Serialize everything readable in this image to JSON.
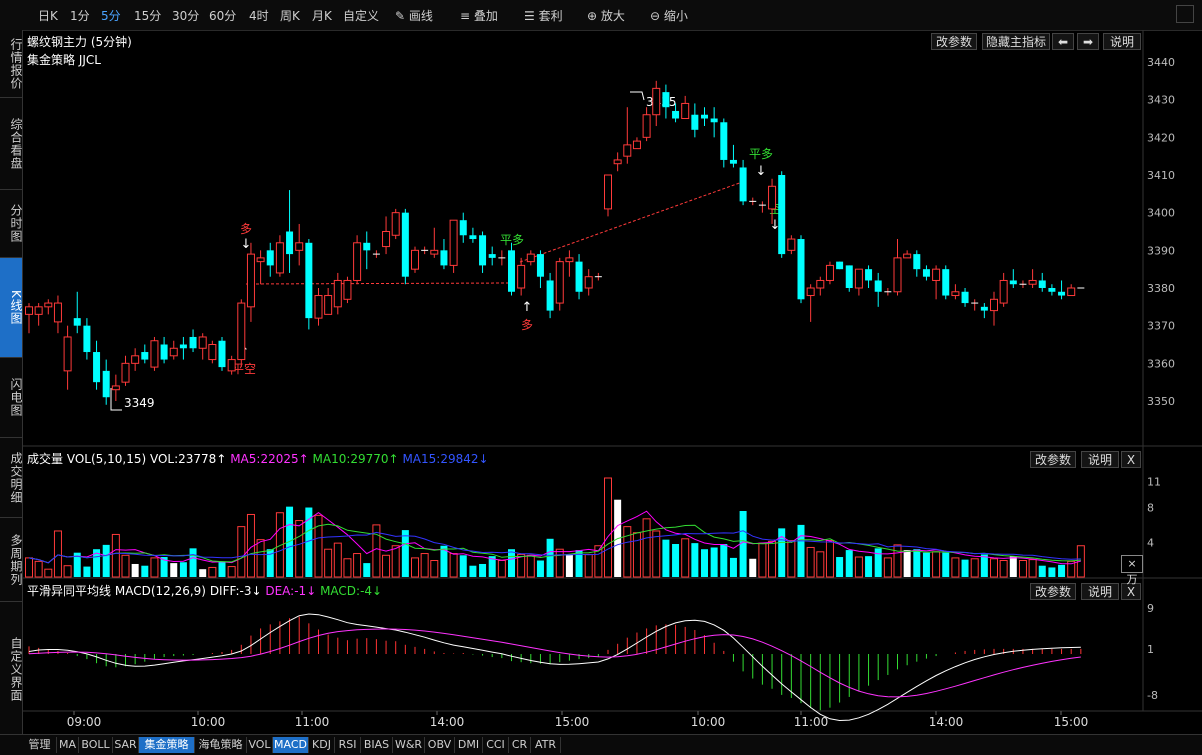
{
  "toolbar": {
    "periods": [
      "日K",
      "1分",
      "5分",
      "15分",
      "30分",
      "60分",
      "4时",
      "周K",
      "月K",
      "自定义"
    ],
    "selected_period": "5分",
    "draw_label": "画线",
    "overlay_label": "叠加",
    "arbitrage_label": "套利",
    "zoom_in_label": "放大",
    "zoom_out_label": "缩小"
  },
  "sidebar": {
    "items": [
      {
        "label": "行情报价"
      },
      {
        "label": "综合看盘"
      },
      {
        "label": "分时图"
      },
      {
        "label": "K线图",
        "selected": true
      },
      {
        "label": "闪电图"
      },
      {
        "label": "成交明细"
      },
      {
        "label": "多周期列"
      },
      {
        "label": "自定义界面"
      }
    ]
  },
  "main_panel": {
    "title": "螺纹钢主力 (5分钟)",
    "strategy": "集金策略 JJCL",
    "buttons": {
      "params": "改参数",
      "hide": "隐藏主指标",
      "help": "说明"
    },
    "y_ticks": [
      3440,
      3430,
      3420,
      3410,
      3400,
      3390,
      3380,
      3370,
      3360,
      3350
    ],
    "annotations": {
      "high": "3435",
      "low": "3349"
    },
    "signals": {
      "buy_open_1": "多",
      "close_short_1": "平空",
      "close_long_1": "平多",
      "buy_open_2": "多",
      "close_long_2": "平多",
      "sell_open": "空"
    }
  },
  "vol_panel": {
    "label": "成交量",
    "params": "VOL(5,10,15)",
    "vol": "VOL:23778↑",
    "ma5": "MA5:22025↑",
    "ma10": "MA10:29770↑",
    "ma15": "MA15:29842↓",
    "y_ticks": [
      "11",
      "8",
      "4"
    ],
    "unit": "×万",
    "buttons": {
      "params": "改参数",
      "help": "说明",
      "close": "X"
    }
  },
  "macd_panel": {
    "label": "平滑异同平均线",
    "params": "MACD(12,26,9)",
    "diff": "DIFF:-3↓",
    "dea": "DEA:-1↓",
    "macd": "MACD:-4↓",
    "y_ticks": [
      "9",
      "1",
      "-8"
    ],
    "buttons": {
      "params": "改参数",
      "help": "说明",
      "close": "X"
    }
  },
  "time_axis": [
    "09:00",
    "10:00",
    "11:00",
    "14:00",
    "15:00",
    "10:00",
    "11:00",
    "14:00",
    "15:00"
  ],
  "bottom_tabs": [
    "管理",
    "MA",
    "BOLL",
    "SAR",
    "集金策略",
    "海龟策略",
    "VOL",
    "MACD",
    "KDJ",
    "RSI",
    "BIAS",
    "W&R",
    "OBV",
    "DMI",
    "CCI",
    "CR",
    "ATR"
  ],
  "colors": {
    "up": "#ff3a3a",
    "down": "#00ffff",
    "ma5": "#ff00ff",
    "ma10": "#33dd33",
    "ma15": "#3333ff",
    "diff": "#ffffff",
    "dea": "#ff33ff",
    "macd_up": "#ff3333",
    "macd_down": "#33dd33",
    "panel_border": "#333333",
    "selected": "#1e6fc7"
  },
  "chart_data": {
    "type": "candlestick",
    "ylim": [
      3345,
      3442
    ],
    "candles": [
      [
        3373,
        3375,
        3368,
        3376
      ],
      [
        3373,
        3375,
        3370,
        3376
      ],
      [
        3375,
        3376,
        3373,
        3377
      ],
      [
        3371,
        3376,
        3368,
        3378
      ],
      [
        3358,
        3367,
        3353,
        3370
      ],
      [
        3372,
        3370,
        3368,
        3379
      ],
      [
        3370,
        3363,
        3361,
        3372
      ],
      [
        3363,
        3355,
        3353,
        3366
      ],
      [
        3358,
        3351,
        3349,
        3361
      ],
      [
        3353,
        3354,
        3350,
        3357
      ],
      [
        3355,
        3360,
        3354,
        3362
      ],
      [
        3360,
        3362,
        3358,
        3364
      ],
      [
        3363,
        3361,
        3360,
        3365
      ],
      [
        3359,
        3366,
        3358,
        3367
      ],
      [
        3365,
        3361,
        3360,
        3367
      ],
      [
        3362,
        3364,
        3361,
        3366
      ],
      [
        3365,
        3364,
        3361,
        3367
      ],
      [
        3367,
        3364,
        3363,
        3369
      ],
      [
        3364,
        3367,
        3361,
        3368
      ],
      [
        3361,
        3365,
        3360,
        3366
      ],
      [
        3366,
        3359,
        3358,
        3367
      ],
      [
        3358,
        3361,
        3357,
        3362
      ],
      [
        3361,
        3376,
        3359,
        3377
      ],
      [
        3375,
        3389,
        3371,
        3392
      ],
      [
        3387,
        3388,
        3381,
        3390
      ],
      [
        3390,
        3386,
        3383,
        3392
      ],
      [
        3384,
        3392,
        3383,
        3394
      ],
      [
        3395,
        3389,
        3384,
        3406
      ],
      [
        3390,
        3392,
        3386,
        3397
      ],
      [
        3392,
        3372,
        3369,
        3393
      ],
      [
        3372,
        3378,
        3370,
        3380
      ],
      [
        3373,
        3378,
        3374,
        3380
      ],
      [
        3375,
        3382,
        3373,
        3384
      ],
      [
        3377,
        3382,
        3376,
        3383
      ],
      [
        3382,
        3392,
        3381,
        3394
      ],
      [
        3392,
        3390,
        3385,
        3395
      ],
      [
        3389,
        3389,
        3388,
        3390
      ],
      [
        3391,
        3395,
        3389,
        3399
      ],
      [
        3394,
        3400,
        3393,
        3401
      ],
      [
        3400,
        3383,
        3381,
        3401
      ],
      [
        3385,
        3390,
        3384,
        3391
      ],
      [
        3390,
        3390,
        3389,
        3391
      ],
      [
        3389,
        3390,
        3388,
        3396
      ],
      [
        3390,
        3386,
        3385,
        3393
      ],
      [
        3386,
        3398,
        3384,
        3398
      ],
      [
        3398,
        3394,
        3392,
        3400
      ],
      [
        3394,
        3393,
        3392,
        3396
      ],
      [
        3394,
        3386,
        3384,
        3395
      ],
      [
        3389,
        3388,
        3386,
        3391
      ],
      [
        3388,
        3388,
        3386,
        3390
      ],
      [
        3390,
        3379,
        3378,
        3392
      ],
      [
        3380,
        3386,
        3378,
        3388
      ],
      [
        3387,
        3389,
        3386,
        3390
      ],
      [
        3389,
        3383,
        3380,
        3390
      ],
      [
        3382,
        3374,
        3372,
        3384
      ],
      [
        3376,
        3387,
        3374,
        3388
      ],
      [
        3387,
        3388,
        3383,
        3390
      ],
      [
        3387,
        3379,
        3377,
        3389
      ],
      [
        3380,
        3383,
        3378,
        3385
      ],
      [
        3383,
        3383,
        3382,
        3384
      ],
      [
        3401,
        3410,
        3399,
        3410
      ],
      [
        3413,
        3414,
        3411,
        3416
      ],
      [
        3415,
        3418,
        3413,
        3428
      ],
      [
        3417,
        3419,
        3417,
        3420
      ],
      [
        3420,
        3426,
        3419,
        3428
      ],
      [
        3426,
        3433,
        3423,
        3435
      ],
      [
        3432,
        3428,
        3425,
        3434
      ],
      [
        3427,
        3425,
        3424,
        3429
      ],
      [
        3425,
        3429,
        3426,
        3431
      ],
      [
        3426,
        3422,
        3420,
        3429
      ],
      [
        3426,
        3425,
        3423,
        3428
      ],
      [
        3425,
        3424,
        3420,
        3428
      ],
      [
        3424,
        3414,
        3412,
        3425
      ],
      [
        3414,
        3413,
        3412,
        3418
      ],
      [
        3412,
        3403,
        3402,
        3414
      ],
      [
        3403,
        3403,
        3402,
        3404
      ],
      [
        3402,
        3402,
        3400,
        3403
      ],
      [
        3401,
        3407,
        3397,
        3409
      ],
      [
        3410,
        3389,
        3388,
        3411
      ],
      [
        3390,
        3393,
        3389,
        3394
      ],
      [
        3393,
        3377,
        3376,
        3394
      ],
      [
        3378,
        3380,
        3371,
        3381
      ],
      [
        3380,
        3382,
        3378,
        3383
      ],
      [
        3382,
        3386,
        3381,
        3387
      ],
      [
        3387,
        3385,
        3385,
        3387
      ],
      [
        3386,
        3380,
        3379,
        3386
      ],
      [
        3380,
        3385,
        3378,
        3385
      ],
      [
        3385,
        3382,
        3380,
        3386
      ],
      [
        3382,
        3379,
        3375,
        3384
      ],
      [
        3379,
        3379,
        3378,
        3380
      ],
      [
        3379,
        3388,
        3378,
        3393
      ],
      [
        3388,
        3389,
        3388,
        3390
      ],
      [
        3389,
        3385,
        3383,
        3390
      ],
      [
        3385,
        3383,
        3382,
        3386
      ],
      [
        3382,
        3385,
        3377,
        3386
      ],
      [
        3385,
        3378,
        3377,
        3386
      ],
      [
        3378,
        3379,
        3377,
        3381
      ],
      [
        3379,
        3376,
        3375,
        3380
      ],
      [
        3376,
        3376,
        3374,
        3377
      ],
      [
        3375,
        3374,
        3372,
        3376
      ],
      [
        3374,
        3377,
        3370,
        3379
      ],
      [
        3376,
        3382,
        3375,
        3384
      ],
      [
        3382,
        3381,
        3380,
        3385
      ],
      [
        3381,
        3381,
        3380,
        3382
      ],
      [
        3381,
        3382,
        3380,
        3385
      ],
      [
        3382,
        3380,
        3379,
        3384
      ],
      [
        3380,
        3379,
        3378,
        3381
      ],
      [
        3379,
        3378,
        3377,
        3382
      ],
      [
        3378,
        3380,
        3378,
        3381
      ],
      [
        3380,
        3380,
        3380,
        3380
      ]
    ],
    "volume": [
      2.2,
      1.8,
      0.9,
      5.3,
      1.3,
      2.8,
      1.2,
      3.2,
      3.7,
      4.9,
      2.5,
      1.5,
      1.3,
      2.2,
      2.3,
      1.6,
      1.7,
      3.3,
      0.9,
      1.1,
      1.8,
      1.2,
      5.8,
      7.2,
      4.3,
      3.2,
      7.4,
      8.1,
      6.5,
      8.0,
      7.1,
      3.2,
      3.9,
      2.1,
      2.7,
      1.6,
      6.0,
      2.5,
      3.6,
      5.4,
      2.2,
      2.7,
      1.9,
      3.6,
      2.7,
      2.5,
      1.3,
      1.5,
      2.4,
      1.9,
      3.2,
      2.6,
      2.5,
      1.9,
      4.4,
      3.2,
      2.6,
      3.1,
      2.6,
      3.6,
      11.4,
      8.9,
      5.8,
      5.1,
      6.7,
      5.3,
      4.3,
      3.8,
      4.4,
      3.9,
      3.2,
      3.4,
      3.8,
      2.2,
      7.6,
      2.1,
      3.9,
      4.1,
      5.6,
      4.2,
      6.0,
      3.4,
      2.9,
      4.2,
      2.3,
      3.1,
      2.3,
      2.4,
      3.3,
      2.2,
      3.7,
      3.1,
      3.2,
      2.8,
      2.9,
      2.8,
      2.2,
      2.0,
      2.1,
      2.6,
      2.1,
      1.9,
      2.4,
      1.9,
      2.0,
      1.3,
      1.1,
      1.4,
      1.8,
      3.6
    ],
    "volume_white": [
      11,
      15,
      18,
      56,
      61,
      75,
      91,
      102
    ],
    "macd": [
      1.5,
      1.2,
      0.8,
      0.6,
      0.2,
      -0.4,
      -1.0,
      -1.8,
      -2.4,
      -2.6,
      -2.4,
      -2.0,
      -1.5,
      -1.0,
      -0.6,
      -0.4,
      -0.3,
      -0.2,
      0.0,
      0.2,
      0.4,
      0.8,
      1.8,
      3.6,
      5.0,
      5.8,
      6.4,
      7.0,
      7.3,
      6.0,
      4.8,
      3.8,
      3.2,
      2.7,
      3.0,
      3.1,
      2.9,
      2.6,
      2.5,
      1.8,
      1.4,
      1.0,
      0.5,
      0.2,
      0.1,
      0.2,
      -0.1,
      -0.3,
      -0.6,
      -0.8,
      -1.4,
      -1.6,
      -1.8,
      -1.9,
      -2.0,
      -1.6,
      -1.3,
      -1.0,
      -0.8,
      -0.6,
      0.8,
      2.0,
      3.2,
      4.2,
      5.0,
      5.6,
      5.8,
      5.7,
      5.3,
      4.7,
      3.7,
      2.2,
      0.6,
      -1.5,
      -3.4,
      -4.8,
      -6.0,
      -6.8,
      -8.0,
      -8.6,
      -9.6,
      -10.6,
      -11.0,
      -10.5,
      -9.5,
      -8.4,
      -7.3,
      -6.2,
      -5.1,
      -4.1,
      -3.0,
      -2.2,
      -1.5,
      -0.9,
      -0.4,
      0.0,
      0.3,
      0.6,
      0.8,
      0.9,
      1.0,
      1.0,
      1.0,
      1.0,
      1.0,
      1.0,
      1.0,
      1.0,
      1.0,
      1.0
    ]
  }
}
